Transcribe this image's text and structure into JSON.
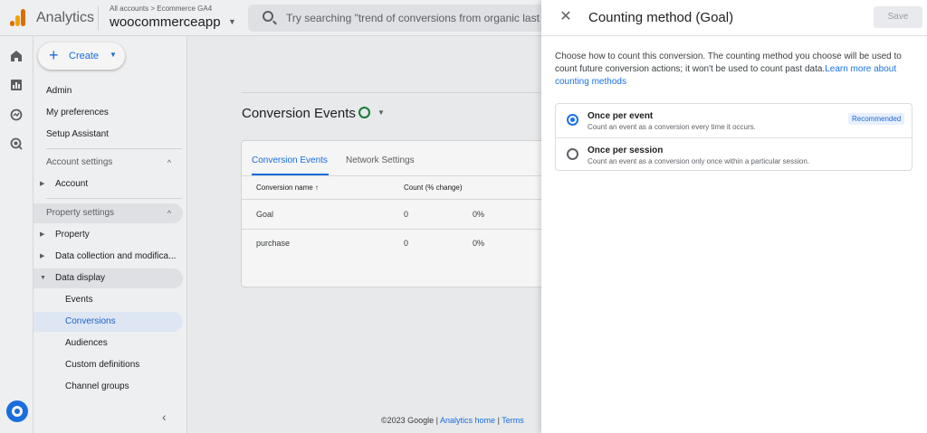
{
  "header": {
    "app_name": "Analytics",
    "breadcrumb": "All accounts > Ecommerce GA4",
    "account_name": "woocommerceapp",
    "search_placeholder": "Try searching \"trend of conversions from organic last m"
  },
  "sidebar": {
    "create_label": "Create",
    "items": [
      {
        "label": "Admin"
      },
      {
        "label": "My preferences"
      },
      {
        "label": "Setup Assistant"
      },
      {
        "label": "Account settings"
      },
      {
        "label": "Account"
      },
      {
        "label": "Property settings"
      },
      {
        "label": "Property"
      },
      {
        "label": "Data collection and modifica..."
      },
      {
        "label": "Data display"
      },
      {
        "label": "Events"
      },
      {
        "label": "Conversions"
      },
      {
        "label": "Audiences"
      },
      {
        "label": "Custom definitions"
      },
      {
        "label": "Channel groups"
      }
    ]
  },
  "main": {
    "title": "Conversion Events",
    "tabs": [
      {
        "label": "Conversion Events"
      },
      {
        "label": "Network Settings"
      }
    ],
    "columns": [
      "Conversion name ↑",
      "Count (% change)"
    ],
    "rows": [
      {
        "name": "Goal",
        "count": "0",
        "change": "0%"
      },
      {
        "name": "purchase",
        "count": "0",
        "change": "0%"
      }
    ],
    "footer": {
      "copyright": "©2023 Google | ",
      "home_link": "Analytics home",
      "sep": " | ",
      "terms_link": "Terms"
    }
  },
  "drawer": {
    "title": "Counting method (Goal)",
    "save_label": "Save",
    "description": "Choose how to count this conversion. The counting method you choose will be used to count future conversion actions; it won't be used to count past data.",
    "learn_more": "Learn more about counting methods",
    "options": [
      {
        "title": "Once per event",
        "subtitle": "Count an event as a conversion every time it occurs.",
        "badge": "Recommended",
        "selected": true
      },
      {
        "title": "Once per session",
        "subtitle": "Count an event as a conversion only once within a particular session.",
        "selected": false
      }
    ]
  },
  "colors": {
    "accent": "#1a73e8",
    "success": "#188038",
    "logo_orange": "#e37400",
    "logo_yellow": "#f9ab00"
  }
}
